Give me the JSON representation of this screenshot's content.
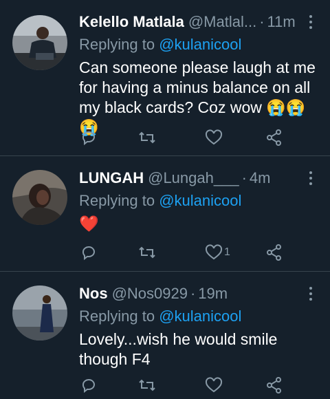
{
  "tweets": [
    {
      "name": "Kelello Matlala",
      "handle": "@Matlal...",
      "dot": "·",
      "time": "11m",
      "replying_prefix": "Replying to",
      "replying_to": "@kulanicool",
      "text": "Can someone please laugh at me for having a minus balance on all my black cards? Coz wow 😭😭😭",
      "like_count": ""
    },
    {
      "name": "LUNGAH",
      "handle": "@Lungah___",
      "dot": "·",
      "time": "4m",
      "replying_prefix": "Replying to",
      "replying_to": "@kulanicool",
      "text": "❤️",
      "like_count": "1"
    },
    {
      "name": "Nos",
      "handle": "@Nos0929",
      "dot": "·",
      "time": "19m",
      "replying_prefix": "Replying to",
      "replying_to": "@kulanicool",
      "text": "Lovely...wish he would smile though F4",
      "like_count": ""
    }
  ],
  "icons": {
    "reply": "reply-icon",
    "retweet": "retweet-icon",
    "like": "heart-icon",
    "share": "share-icon",
    "more": "more-icon"
  },
  "colors": {
    "background": "#15202b",
    "secondary_text": "#8899a6",
    "mention": "#1da1f2",
    "divider": "#38444d",
    "heart_emoji": "#e0245e"
  }
}
